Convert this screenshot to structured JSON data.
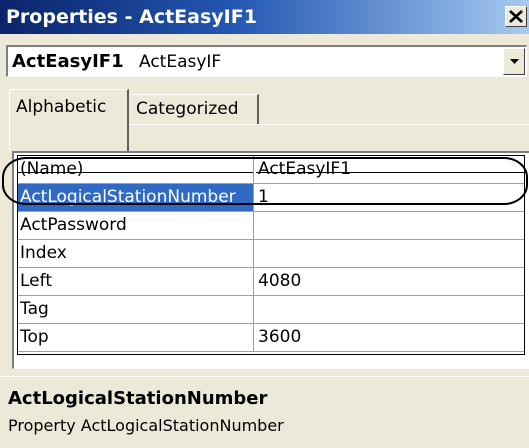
{
  "window": {
    "title": "Properties - ActEasyIF1"
  },
  "object_selector": {
    "name": "ActEasyIF1",
    "type": "ActEasyIF"
  },
  "tabs": [
    {
      "label": "Alphabetic",
      "active": true
    },
    {
      "label": "Categorized",
      "active": false
    }
  ],
  "properties": [
    {
      "name": "(Name)",
      "value": "ActEasyIF1"
    },
    {
      "name": "ActLogicalStationNumber",
      "value": "1",
      "selected": true
    },
    {
      "name": "ActPassword",
      "value": ""
    },
    {
      "name": "Index",
      "value": ""
    },
    {
      "name": "Left",
      "value": "4080"
    },
    {
      "name": "Tag",
      "value": ""
    },
    {
      "name": "Top",
      "value": "3600"
    }
  ],
  "description": {
    "title": "ActLogicalStationNumber",
    "text": "Property ActLogicalStationNumber"
  },
  "colors": {
    "selection": "#316ac5",
    "titlebar_start": "#0a246a",
    "titlebar_end": "#a6caf0",
    "window_bg": "#ece9d8"
  },
  "icons": {
    "close": "close-icon",
    "dropdown": "chevron-down-icon"
  }
}
